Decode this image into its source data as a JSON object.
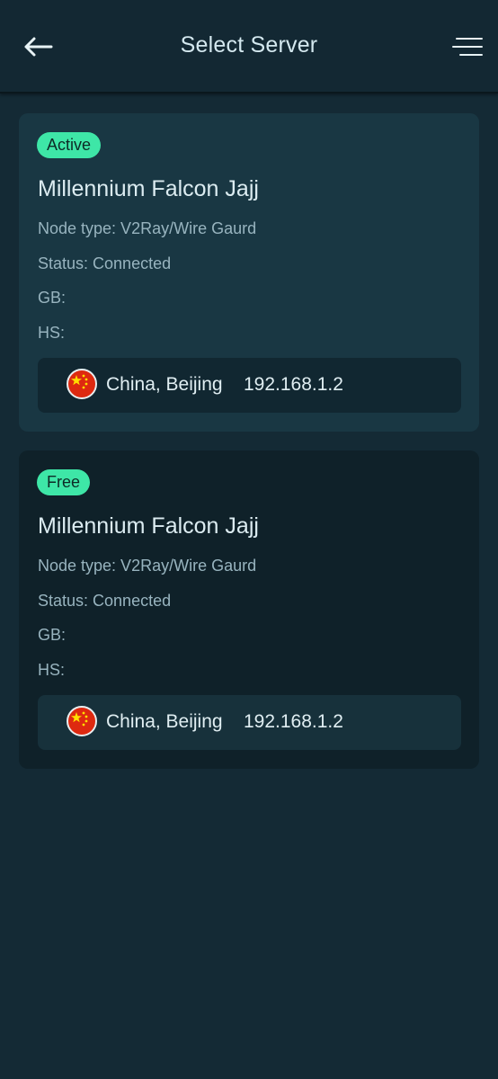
{
  "header": {
    "title": "Select Server",
    "back_icon": "arrow-left-icon",
    "menu_icon": "menu-icon"
  },
  "colors": {
    "background": "#142a35",
    "active_card": "#193743",
    "free_card": "#0f2129",
    "badge": "#3ee6a7",
    "flag_red": "#de2910",
    "flag_yellow": "#ffde00"
  },
  "servers": [
    {
      "badge": "Active",
      "name": "Millennium Falcon Jajj",
      "node_type": "Node type: V2Ray/Wire Gaurd",
      "status": "Status: Connected",
      "gb": "GB:",
      "hs": "HS:",
      "location": "China, Beijing",
      "ip": "192.168.1.2",
      "flag_icon": "china-flag-icon"
    },
    {
      "badge": "Free",
      "name": "Millennium Falcon Jajj",
      "node_type": "Node type: V2Ray/Wire Gaurd",
      "status": "Status: Connected",
      "gb": "GB:",
      "hs": "HS:",
      "location": "China, Beijing",
      "ip": "192.168.1.2",
      "flag_icon": "china-flag-icon"
    }
  ]
}
